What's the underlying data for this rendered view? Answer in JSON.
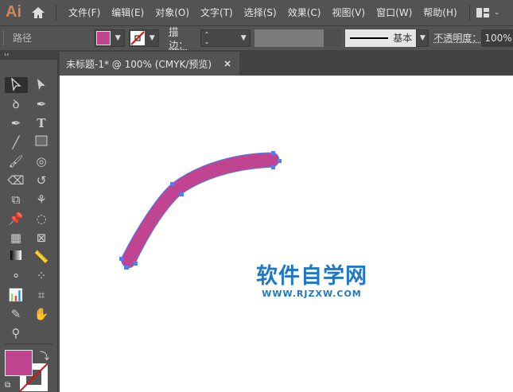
{
  "app": {
    "logo": "Ai"
  },
  "menu": [
    "文件(F)",
    "编辑(E)",
    "对象(O)",
    "文字(T)",
    "选择(S)",
    "效果(C)",
    "视图(V)",
    "窗口(W)",
    "帮助(H)"
  ],
  "control": {
    "selection_type": "路径",
    "fill_color": "#c0448f",
    "stroke_label": "描边：",
    "brush_label": "基本",
    "opacity_label": "不透明度：",
    "opacity_value": "100%"
  },
  "document_tab": {
    "title": "未标题-1* @ 100% (CMYK/预览)",
    "close": "×"
  },
  "toolbar": {
    "collapse": "‹‹",
    "fill_color": "#c0448f"
  },
  "watermark": {
    "title": "软件自学网",
    "url": "WWW.RJZXW.COM"
  }
}
